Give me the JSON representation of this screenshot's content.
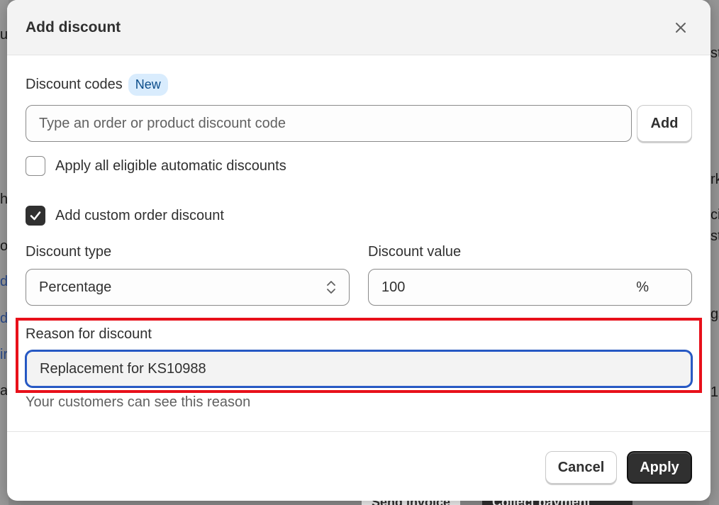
{
  "background": {
    "fragments_left": [
      "u",
      "he",
      "ot",
      "d",
      "d",
      "ir",
      "a"
    ],
    "fragments_right": [
      "st",
      "rk",
      "ci",
      "st",
      "gs",
      "1"
    ],
    "bottom_buttons": [
      "Send invoice",
      "Collect payment"
    ]
  },
  "modal": {
    "title": "Add discount",
    "close_icon": "close-icon"
  },
  "discount_codes": {
    "label": "Discount codes",
    "badge": "New",
    "placeholder": "Type an order or product discount code",
    "value": "",
    "add_label": "Add"
  },
  "automatic": {
    "label": "Apply all eligible automatic discounts",
    "checked": false
  },
  "custom": {
    "label": "Add custom order discount",
    "checked": true
  },
  "discount_type": {
    "label": "Discount type",
    "value": "Percentage"
  },
  "discount_value": {
    "label": "Discount value",
    "value": "100",
    "suffix": "%"
  },
  "reason": {
    "label": "Reason for discount",
    "value": "Replacement for KS10988",
    "help": "Your customers can see this reason"
  },
  "footer": {
    "cancel_label": "Cancel",
    "apply_label": "Apply"
  },
  "colors": {
    "primary": "#303030",
    "highlight": "#e8101a",
    "focus": "#2a5cc8",
    "badge_bg": "#d9ecfd"
  }
}
